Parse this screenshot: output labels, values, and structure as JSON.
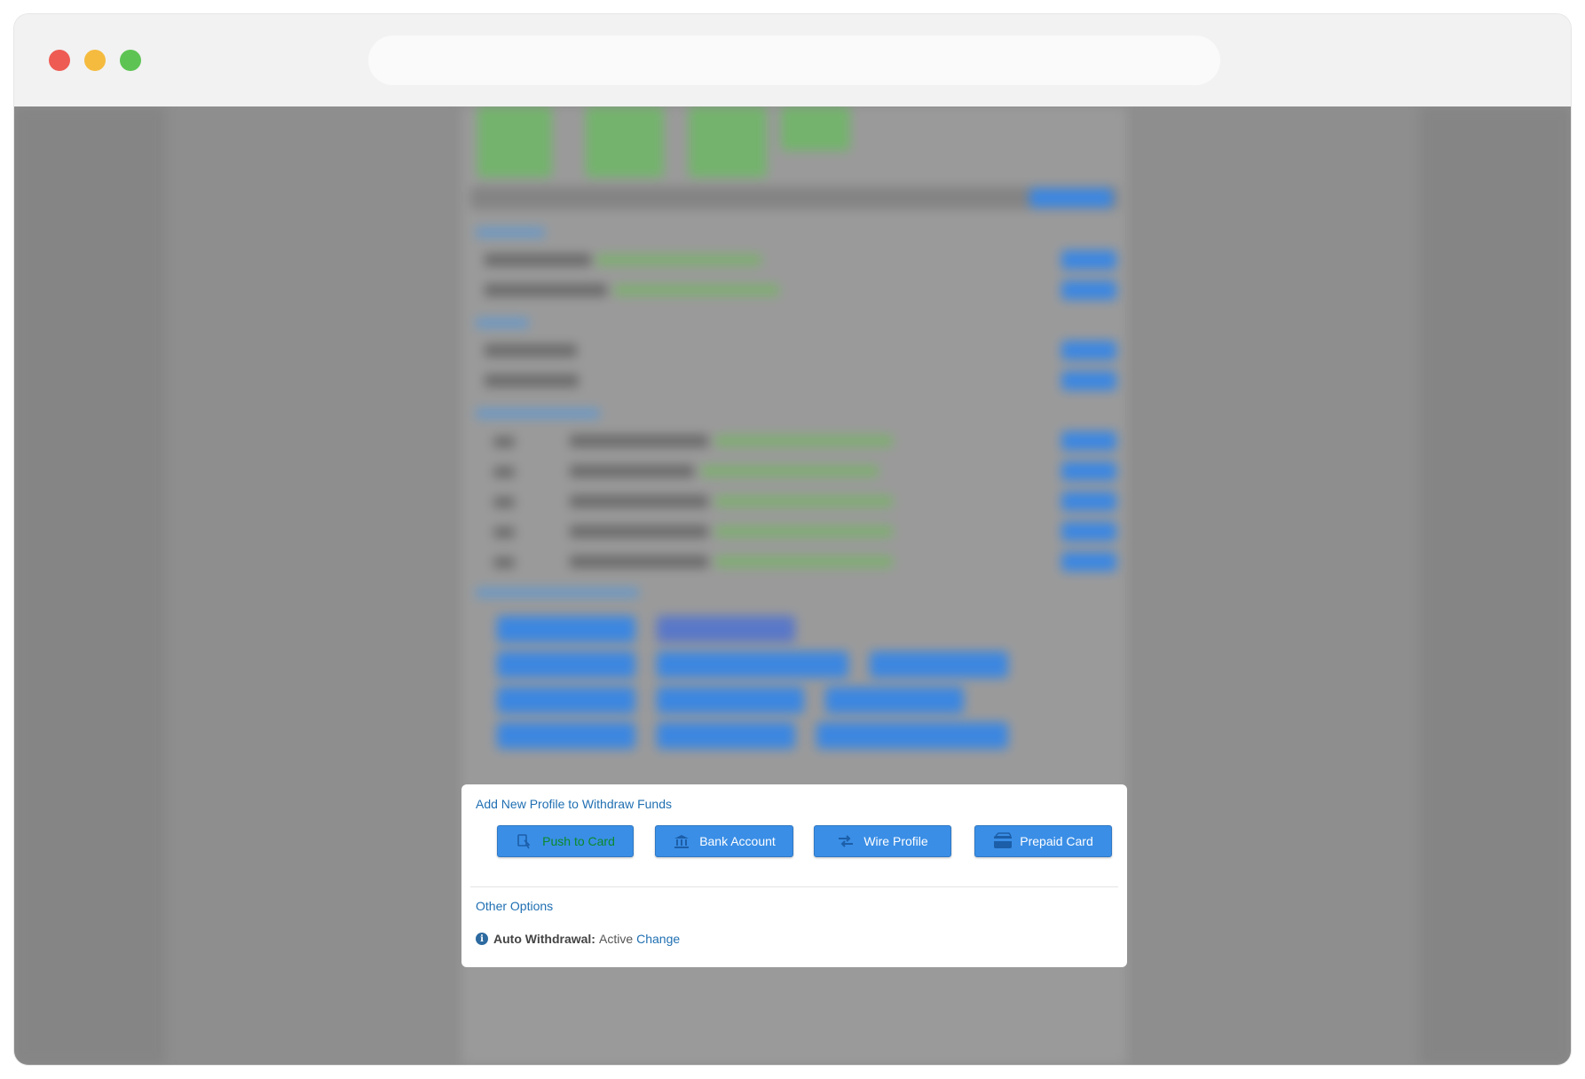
{
  "browser": {
    "controls": [
      "close",
      "minimize",
      "maximize"
    ],
    "address": ""
  },
  "panel": {
    "title": "Add New Profile to Withdraw Funds",
    "buttons": [
      {
        "label": "Push to Card",
        "icon": "card-tap-icon"
      },
      {
        "label": "Bank Account",
        "icon": "bank-icon"
      },
      {
        "label": "Wire Profile",
        "icon": "transfer-arrows-icon"
      },
      {
        "label": "Prepaid Card",
        "icon": "prepaid-card-icon"
      }
    ],
    "other_options_title": "Other Options",
    "auto_withdrawal": {
      "label": "Auto Withdrawal:",
      "status": "Active",
      "action": "Change"
    }
  },
  "colors": {
    "button_blue": "#3a8ee6",
    "link_blue": "#1f6fb2",
    "push_label_green": "#0b8a2a"
  }
}
